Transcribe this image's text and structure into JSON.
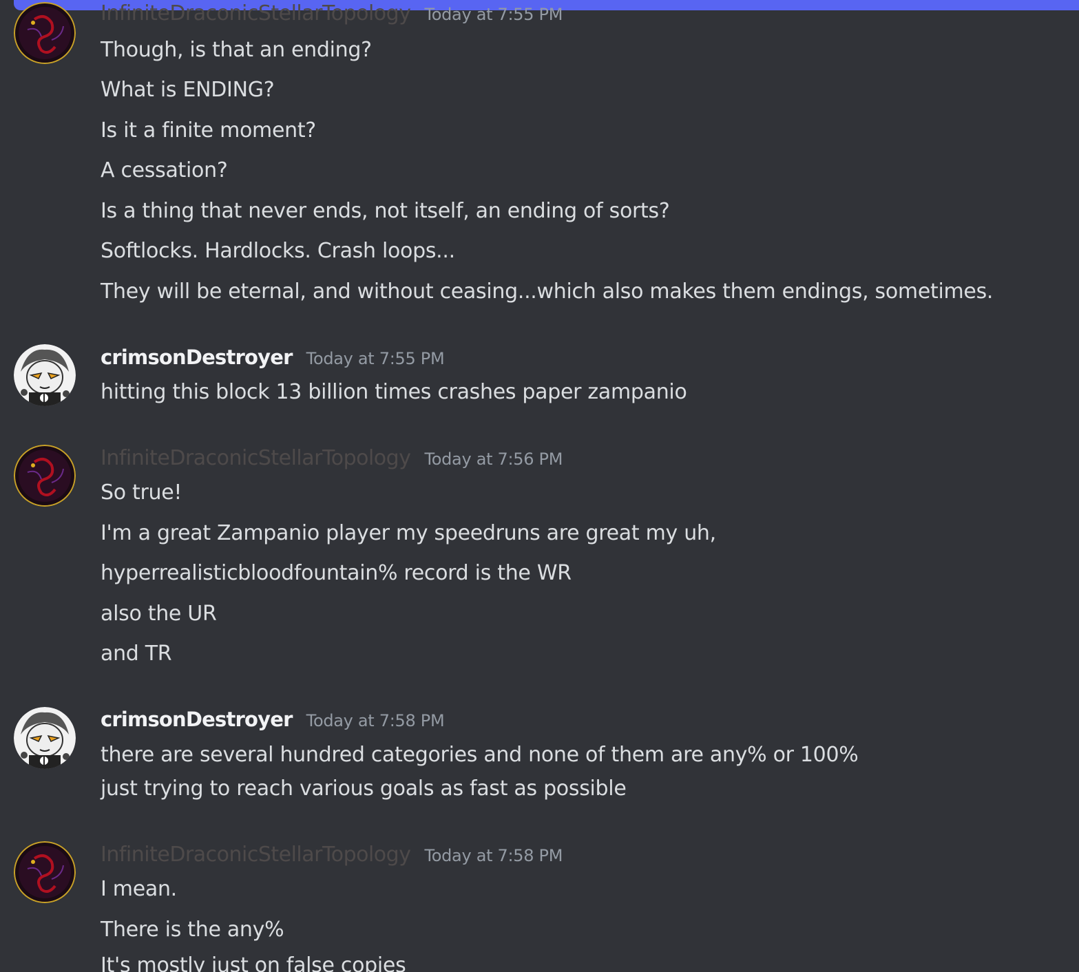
{
  "accent_bar_color": "#5865f2",
  "background_color": "#313338",
  "messages": [
    {
      "username": "InfiniteDraconicStellarTopology",
      "timestamp": "Today at 7:55 PM",
      "avatar_icon": "dragon-avatar-icon",
      "lines": [
        "Though, is that an ending?",
        "What is ENDING?",
        "Is it a finite moment?",
        "A cessation?",
        "Is a thing that never ends, not itself, an ending of sorts?",
        "Softlocks. Hardlocks. Crash loops...",
        "They will be eternal, and without ceasing...which also makes them endings, sometimes."
      ]
    },
    {
      "username": "crimsonDestroyer",
      "timestamp": "Today at 7:55 PM",
      "avatar_icon": "troll-avatar-icon",
      "lines": [
        "hitting this block 13 billion times crashes paper zampanio"
      ]
    },
    {
      "username": "InfiniteDraconicStellarTopology",
      "timestamp": "Today at 7:56 PM",
      "avatar_icon": "dragon-avatar-icon",
      "lines": [
        "So true!",
        "I'm a great Zampanio player my speedruns are great my uh,",
        "hyperrealisticbloodfountain% record is the WR",
        "also the UR",
        "and TR"
      ]
    },
    {
      "username": "crimsonDestroyer",
      "timestamp": "Today at 7:58 PM",
      "avatar_icon": "troll-avatar-icon",
      "lines": [
        "there are several hundred categories and none of them are any% or 100%",
        "just trying to reach various goals as fast as possible"
      ]
    },
    {
      "username": "InfiniteDraconicStellarTopology",
      "timestamp": "Today at 7:58 PM",
      "avatar_icon": "dragon-avatar-icon",
      "lines": [
        "I mean.",
        "There is the any%",
        "It's mostly just on false copies"
      ]
    }
  ]
}
